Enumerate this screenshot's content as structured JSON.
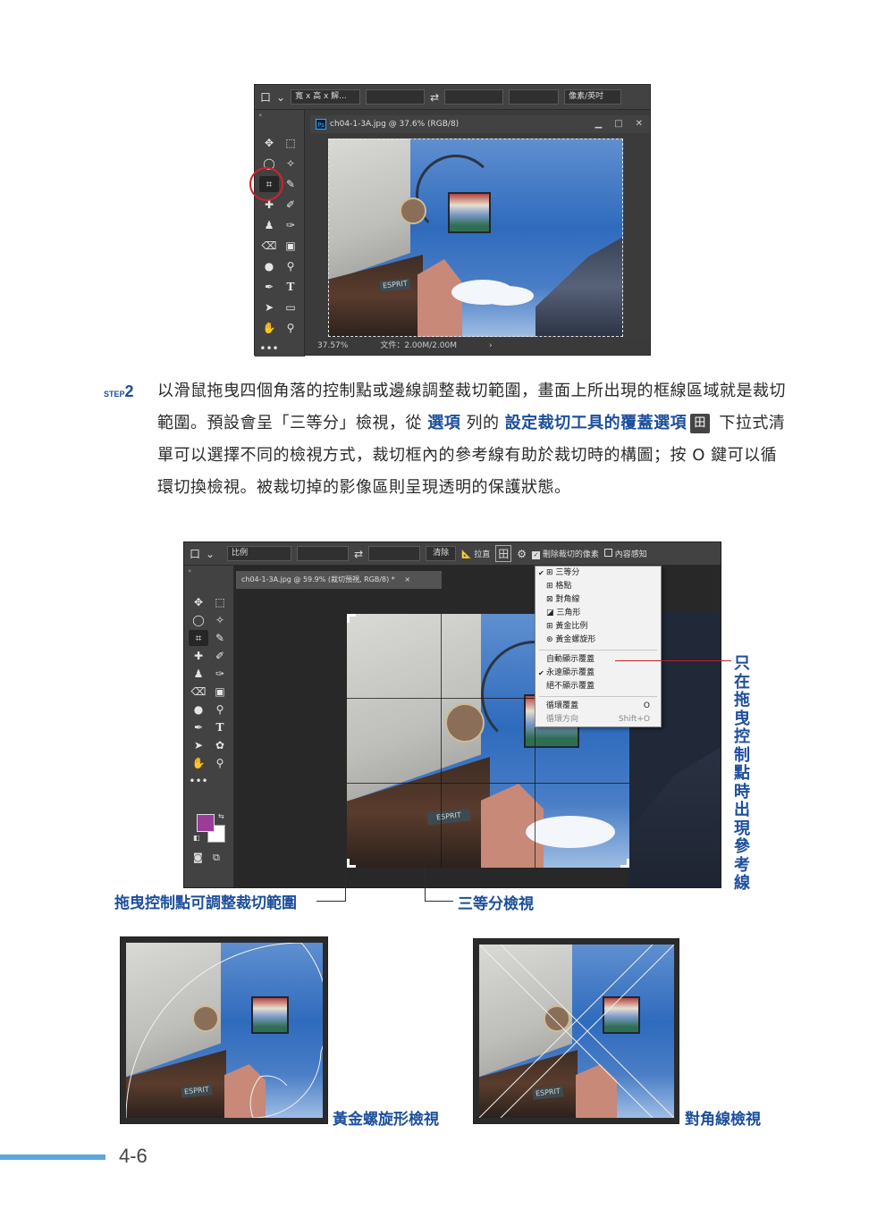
{
  "screenshot1": {
    "options_bar": {
      "crop_tool_glyph": "口",
      "ratio_select": "寬 x 高 x 解...",
      "swap_glyph": "⇄",
      "unit_select": "像素/英吋"
    },
    "doc_tab": {
      "app_badge": "Ps",
      "title": "ch04-1-3A.jpg @ 37.6% (RGB/8)",
      "minimize": "▁",
      "maximize": "□",
      "close": "✕"
    },
    "status": {
      "zoom": "37.57%",
      "file": "文件：2.00M/2.00M",
      "arrow": "›"
    },
    "esprit": "ESPRIT"
  },
  "step": {
    "label": "STEP",
    "number": "2",
    "text_1": "以滑鼠拖曳四個角落的控制點或邊線調整裁切範圍，畫面上所出現的框線區域就是裁切範圍。預設會呈「三等分」檢視，從 ",
    "hl_1": "選項",
    "text_2": " 列的 ",
    "hl_2": "設定裁切工具的覆蓋選項",
    "kbd_icon": "田",
    "text_3": " 下拉式清單可以選擇不同的檢視方式，裁切框內的參考線有助於裁切時的構圖；按 O 鍵可以循環切換檢視。被裁切掉的影像區則呈現透明的保護狀態。"
  },
  "screenshot2": {
    "options_bar": {
      "crop_tool_glyph": "口",
      "ratio_select": "比例",
      "swap_glyph": "⇄",
      "clear_button": "清除",
      "straighten_label": "拉直",
      "overlay_glyph": "田",
      "settings_glyph": "⚙",
      "delete_pixels_label": "刪除裁切的像素",
      "content_aware_label": "內容感知"
    },
    "doc_tab": {
      "title": "ch04-1-3A.jpg @ 59.9% (裁切預視, RGB/8) *",
      "close": "×"
    },
    "dropdown": {
      "overlays": [
        {
          "label": "三等分",
          "checked": true
        },
        {
          "label": "格點",
          "checked": false
        },
        {
          "label": "對角線",
          "checked": false
        },
        {
          "label": "三角形",
          "checked": false
        },
        {
          "label": "黃金比例",
          "checked": false
        },
        {
          "label": "黃金螺旋形",
          "checked": false
        }
      ],
      "display": [
        {
          "label": "自動顯示覆蓋",
          "checked": false
        },
        {
          "label": "永遠顯示覆蓋",
          "checked": true
        },
        {
          "label": "絕不顯示覆蓋",
          "checked": false
        }
      ],
      "cycle": [
        {
          "label": "循環覆蓋",
          "shortcut": "O"
        },
        {
          "label": "循環方向",
          "shortcut": "Shift+O"
        }
      ]
    },
    "esprit": "ESPRIT",
    "colors": {
      "foreground": "#9c3c98",
      "background": "#ffffff"
    }
  },
  "callouts": {
    "auto_show": "只在拖曳控制點時出現參考線",
    "drag_handle": "拖曳控制點可調整裁切範圍",
    "thirds": "三等分檢視",
    "golden_spiral": "黃金螺旋形檢視",
    "diagonal": "對角線檢視"
  },
  "thumbs": {
    "esprit": "ESPRIT"
  },
  "page_number": "4-6",
  "accent_color": "#1d4f9c",
  "footer_color": "#5ba7dc"
}
